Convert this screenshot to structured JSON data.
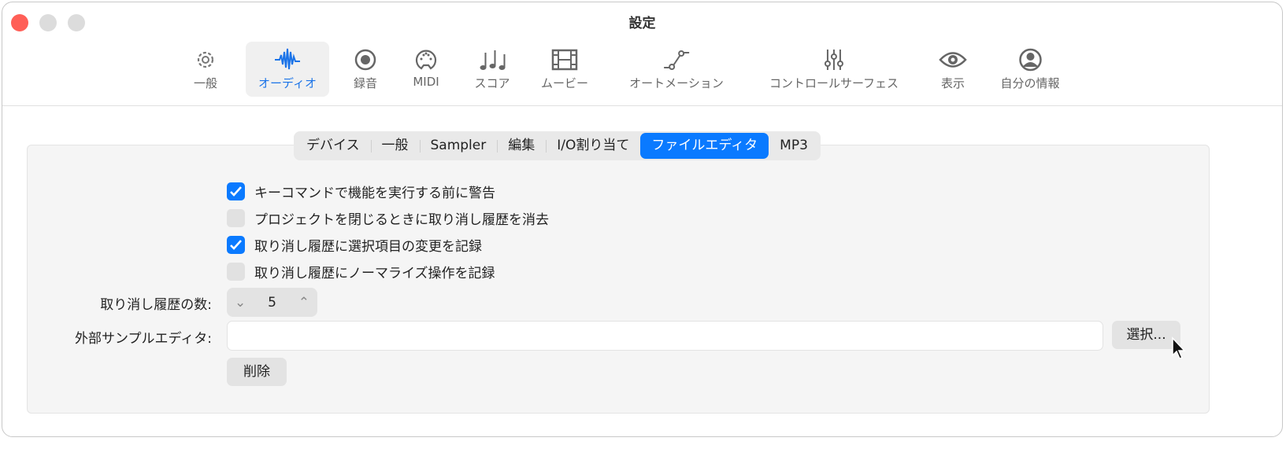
{
  "window": {
    "title": "設定"
  },
  "toolbar": [
    {
      "label": "一般",
      "icon": "gear-icon"
    },
    {
      "label": "オーディオ",
      "icon": "waveform-icon",
      "selected": true
    },
    {
      "label": "録音",
      "icon": "record-icon"
    },
    {
      "label": "MIDI",
      "icon": "midi-icon"
    },
    {
      "label": "スコア",
      "icon": "notes-icon"
    },
    {
      "label": "ムービー",
      "icon": "film-icon"
    },
    {
      "label": "オートメーション",
      "icon": "automation-icon"
    },
    {
      "label": "コントロールサーフェス",
      "icon": "sliders-icon"
    },
    {
      "label": "表示",
      "icon": "eye-icon"
    },
    {
      "label": "自分の情報",
      "icon": "person-icon"
    }
  ],
  "tabs": [
    "デバイス",
    "一般",
    "Sampler",
    "編集",
    "I/O割り当て",
    "ファイルエディタ",
    "MP3"
  ],
  "active_tab": "ファイルエディタ",
  "checkboxes": [
    {
      "label": "キーコマンドで機能を実行する前に警告",
      "checked": true
    },
    {
      "label": "プロジェクトを閉じるときに取り消し履歴を消去",
      "checked": false
    },
    {
      "label": "取り消し履歴に選択項目の変更を記録",
      "checked": true
    },
    {
      "label": "取り消し履歴にノーマライズ操作を記録",
      "checked": false
    }
  ],
  "undo_count": {
    "label": "取り消し履歴の数:",
    "value": "5"
  },
  "external_editor": {
    "label": "外部サンプルエディタ:",
    "value": "",
    "select_label": "選択...",
    "delete_label": "削除"
  },
  "colors": {
    "accent": "#0a7aff",
    "close": "#ff5f57",
    "inactive": "#dcdcdc"
  }
}
